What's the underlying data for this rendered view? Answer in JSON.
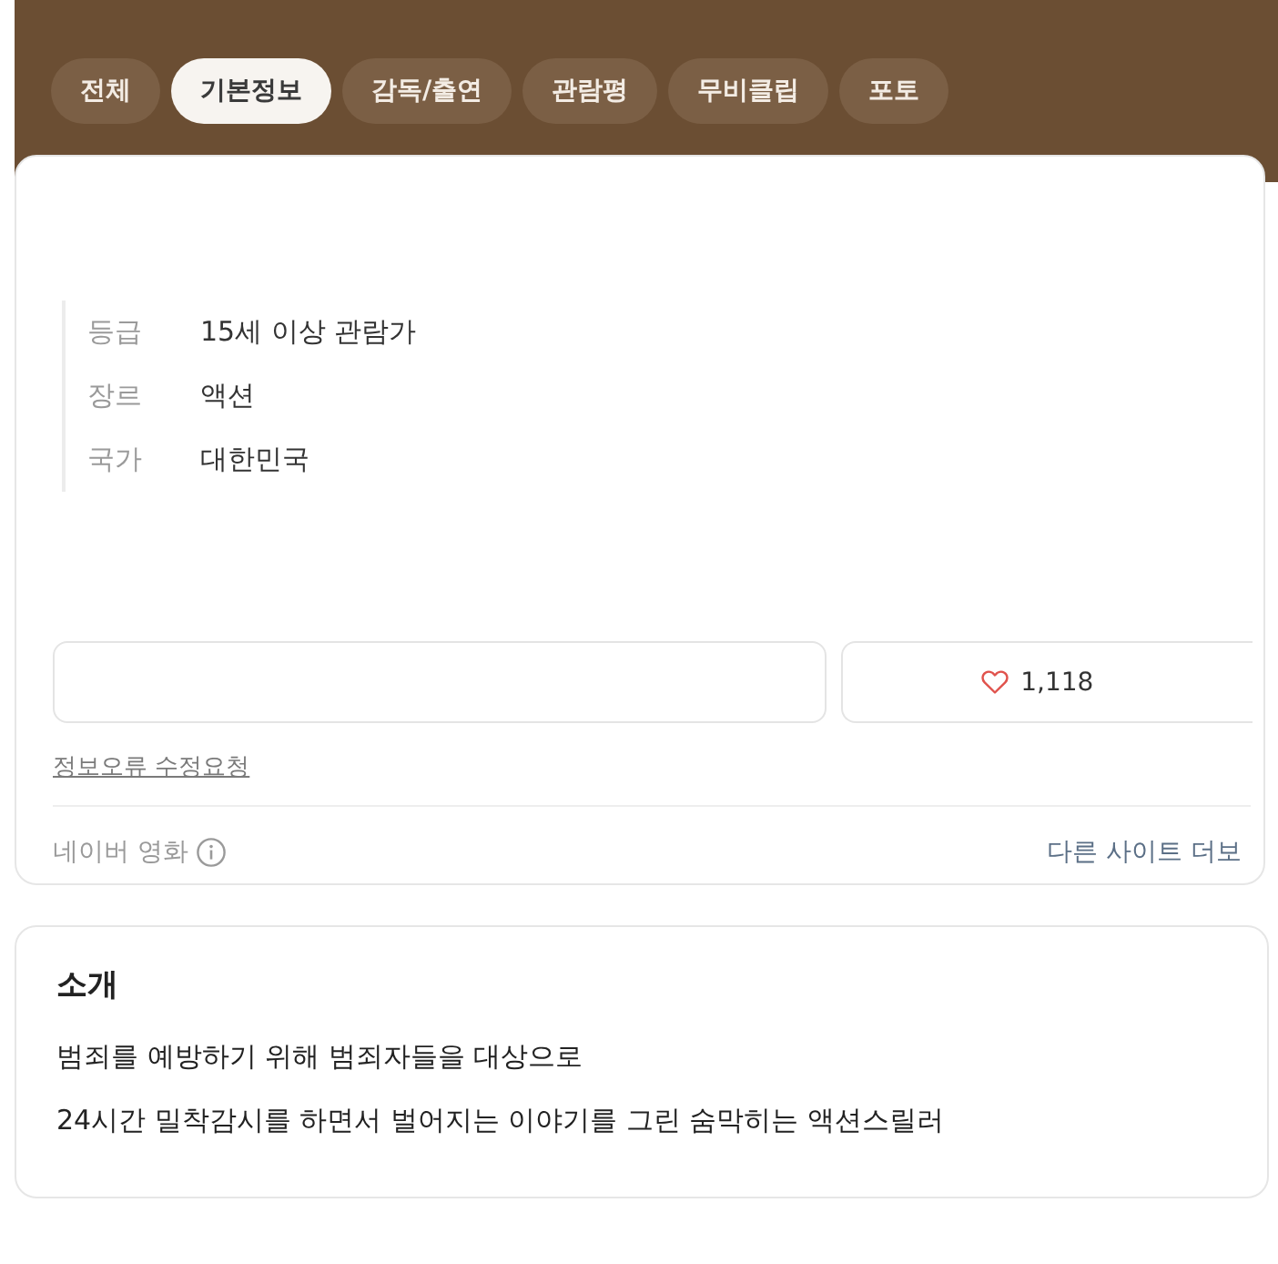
{
  "tabs": [
    {
      "label": "전체",
      "selected": false
    },
    {
      "label": "기본정보",
      "selected": true
    },
    {
      "label": "감독/출연",
      "selected": false
    },
    {
      "label": "관람평",
      "selected": false
    },
    {
      "label": "무비클립",
      "selected": false
    },
    {
      "label": "포토",
      "selected": false
    }
  ],
  "info": {
    "rows": [
      {
        "label": "등급",
        "value": "15세 이상 관람가"
      },
      {
        "label": "장르",
        "value": "액션"
      },
      {
        "label": "국가",
        "value": "대한민국"
      }
    ]
  },
  "actions": {
    "like_count": "1,118",
    "liked": false
  },
  "error_report_link": "정보오류 수정요청",
  "source": {
    "label": "네이버 영화",
    "more_link": "다른 사이트 더보"
  },
  "intro": {
    "title": "소개",
    "lines": [
      "범죄를 예방하기 위해 범죄자들을 대상으로",
      "24시간 밀착감시를 하면서 벌어지는 이야기를 그린 숨막히는 액션스릴러"
    ]
  }
}
